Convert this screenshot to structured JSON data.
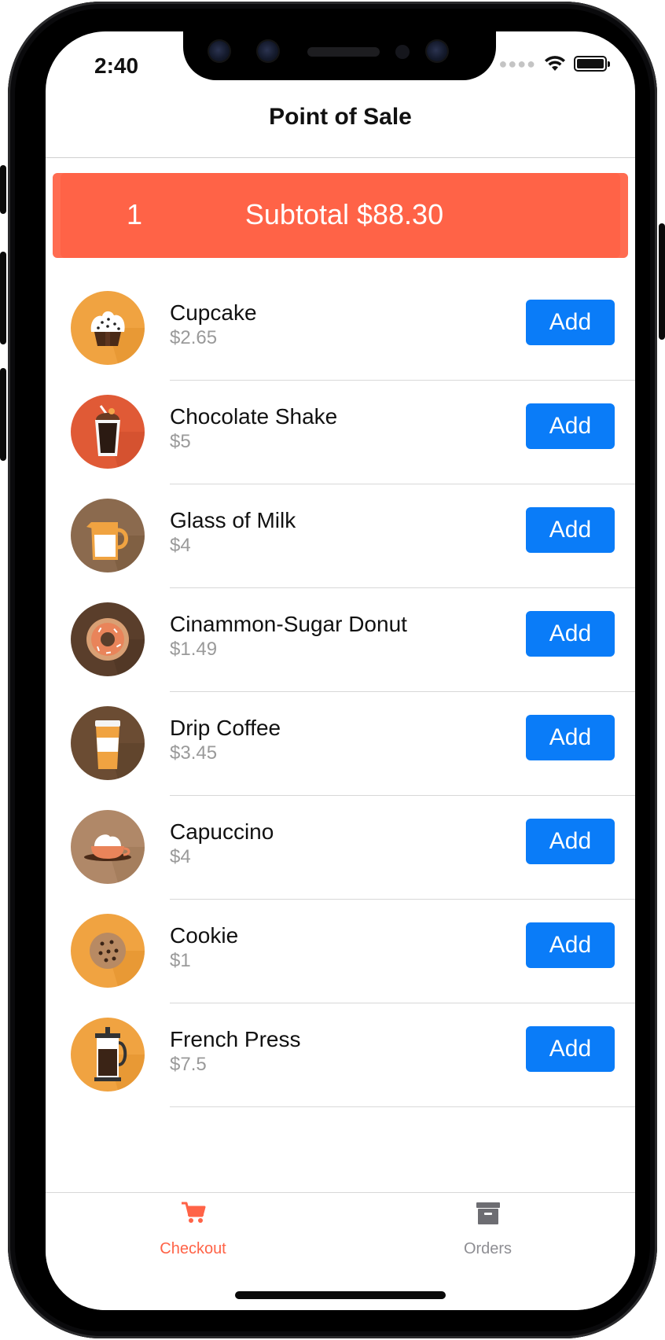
{
  "status_bar": {
    "time": "2:40",
    "icons": [
      "cellular-signal-icon",
      "wifi-icon",
      "battery-icon"
    ]
  },
  "nav": {
    "title": "Point of Sale"
  },
  "cart": {
    "count": "1",
    "subtotal_label": "Subtotal $88.30"
  },
  "products": [
    {
      "name": "Cupcake",
      "price": "$2.65",
      "button": "Add",
      "icon": "cupcake-icon"
    },
    {
      "name": "Chocolate Shake",
      "price": "$5",
      "button": "Add",
      "icon": "chocolate-shake-icon"
    },
    {
      "name": "Glass of Milk",
      "price": "$4",
      "button": "Add",
      "icon": "milk-jug-icon"
    },
    {
      "name": "Cinammon-Sugar Donut",
      "price": "$1.49",
      "button": "Add",
      "icon": "donut-icon"
    },
    {
      "name": "Drip Coffee",
      "price": "$3.45",
      "button": "Add",
      "icon": "coffee-cup-icon"
    },
    {
      "name": "Capuccino",
      "price": "$4",
      "button": "Add",
      "icon": "cappuccino-icon"
    },
    {
      "name": "Cookie",
      "price": "$1",
      "button": "Add",
      "icon": "cookie-icon"
    },
    {
      "name": "French Press",
      "price": "$7.5",
      "button": "Add",
      "icon": "french-press-icon"
    }
  ],
  "tabs": [
    {
      "label": "Checkout",
      "icon": "cart-icon",
      "active": true
    },
    {
      "label": "Orders",
      "icon": "archive-box-icon",
      "active": false
    }
  ],
  "colors": {
    "accent": "#ff6347",
    "button": "#0a7cf8",
    "inactive_tab": "#8e8e93"
  }
}
